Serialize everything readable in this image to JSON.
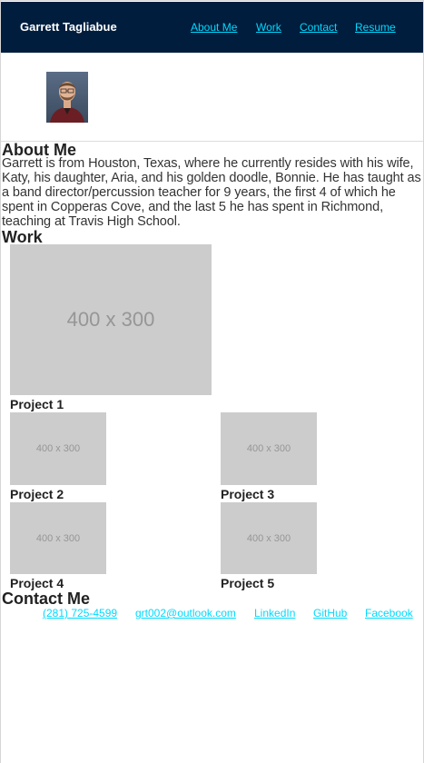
{
  "header": {
    "site_name": "Garrett Tagliabue",
    "nav": [
      "About Me",
      "Work",
      "Contact",
      "Resume"
    ]
  },
  "profile": {
    "photo_icon": "portrait-photo"
  },
  "about": {
    "heading": "About Me",
    "text": "Garrett is from Houston, Texas, where he currently resides with his wife, Katy, his daughter, Aria, and his golden doodle, Bonnie. He has taught as a band director/percussion teacher for 9 years, the first 4 of which he spent in Copperas Cove, and the last 5 he has spent in Richmond, teaching at Travis High School."
  },
  "work": {
    "heading": "Work",
    "projects": [
      {
        "placeholder": "400 x 300",
        "title": "Project 1"
      },
      {
        "placeholder": "400 x 300",
        "title": "Project 2"
      },
      {
        "placeholder": "400 x 300",
        "title": "Project 3"
      },
      {
        "placeholder": "400 x 300",
        "title": "Project 4"
      },
      {
        "placeholder": "400 x 300",
        "title": "Project 5"
      }
    ]
  },
  "contact": {
    "heading": "Contact Me",
    "links": [
      "(281) 725-4599",
      "grt002@outlook.com",
      "LinkedIn",
      "GitHub",
      "Facebook"
    ]
  },
  "colors": {
    "navbar": "#001d3d",
    "link": "#00d9ff",
    "placeholder_bg": "#cccccc",
    "placeholder_text": "#969696"
  }
}
